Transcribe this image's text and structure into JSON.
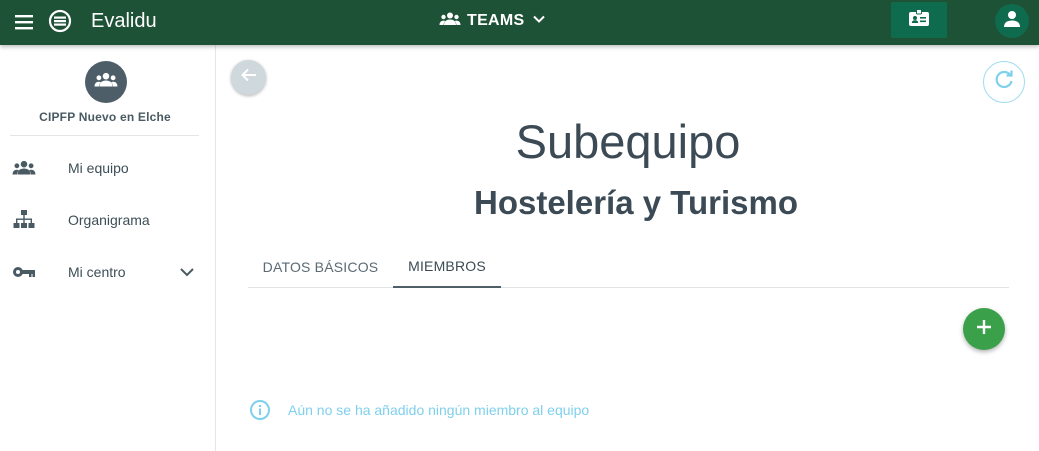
{
  "header": {
    "app_title": "Evalidu",
    "team_selector": "TEAMS",
    "icons": {
      "menu": "menu-icon",
      "logo": "app-logo-icon",
      "teams": "groups-icon",
      "chevron": "chevron-down-icon",
      "badge": "id-card-icon",
      "user": "account-icon"
    },
    "colors": {
      "bar": "#1e5236",
      "button": "#0f6b4d"
    }
  },
  "sidebar": {
    "org_name": "CIPFP Nuevo en Elche",
    "items": [
      {
        "label": "Mi equipo",
        "icon": "groups-icon"
      },
      {
        "label": "Organigrama",
        "icon": "org-chart-icon"
      },
      {
        "label": "Mi centro",
        "icon": "key-icon",
        "expandable": true
      }
    ]
  },
  "main": {
    "title": "Subequipo",
    "subtitle": "Hostelería y Turismo",
    "tabs": [
      {
        "label": "DATOS BÁSICOS",
        "active": false
      },
      {
        "label": "MIEMBROS",
        "active": true
      }
    ],
    "empty_message": "Aún no se ha añadido ningún miembro al equipo",
    "colors": {
      "add_button": "#3aa04a",
      "info": "#7fd0ec"
    }
  }
}
